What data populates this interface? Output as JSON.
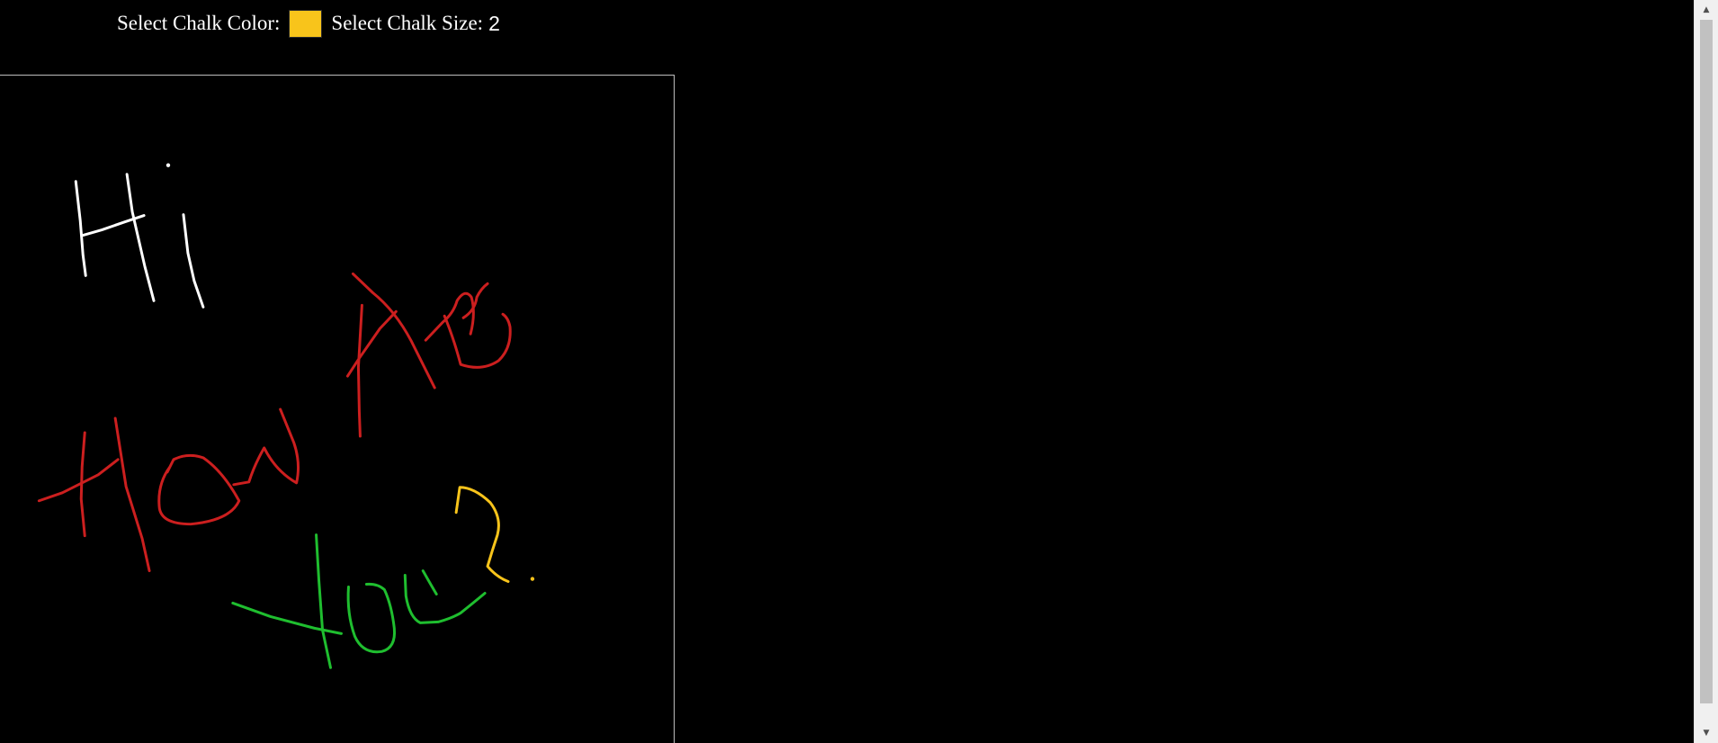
{
  "toolbar": {
    "color_label": "Select Chalk Color:",
    "selected_color": "#f8c41b",
    "size_label": "Select Chalk Size:",
    "size_value": "2"
  },
  "board": {
    "background": "#000000",
    "strokes": [
      {
        "word": "Hi",
        "color": "#ffffff"
      },
      {
        "word": "How",
        "color": "#cc1f1f"
      },
      {
        "word": "Are",
        "color": "#cc1f1f"
      },
      {
        "word": "You",
        "color": "#1fbe2f"
      },
      {
        "word": "?",
        "color": "#f8c41b"
      }
    ]
  },
  "scrollbar": {
    "up_icon": "arrow-up-icon",
    "down_icon": "arrow-down-icon"
  }
}
